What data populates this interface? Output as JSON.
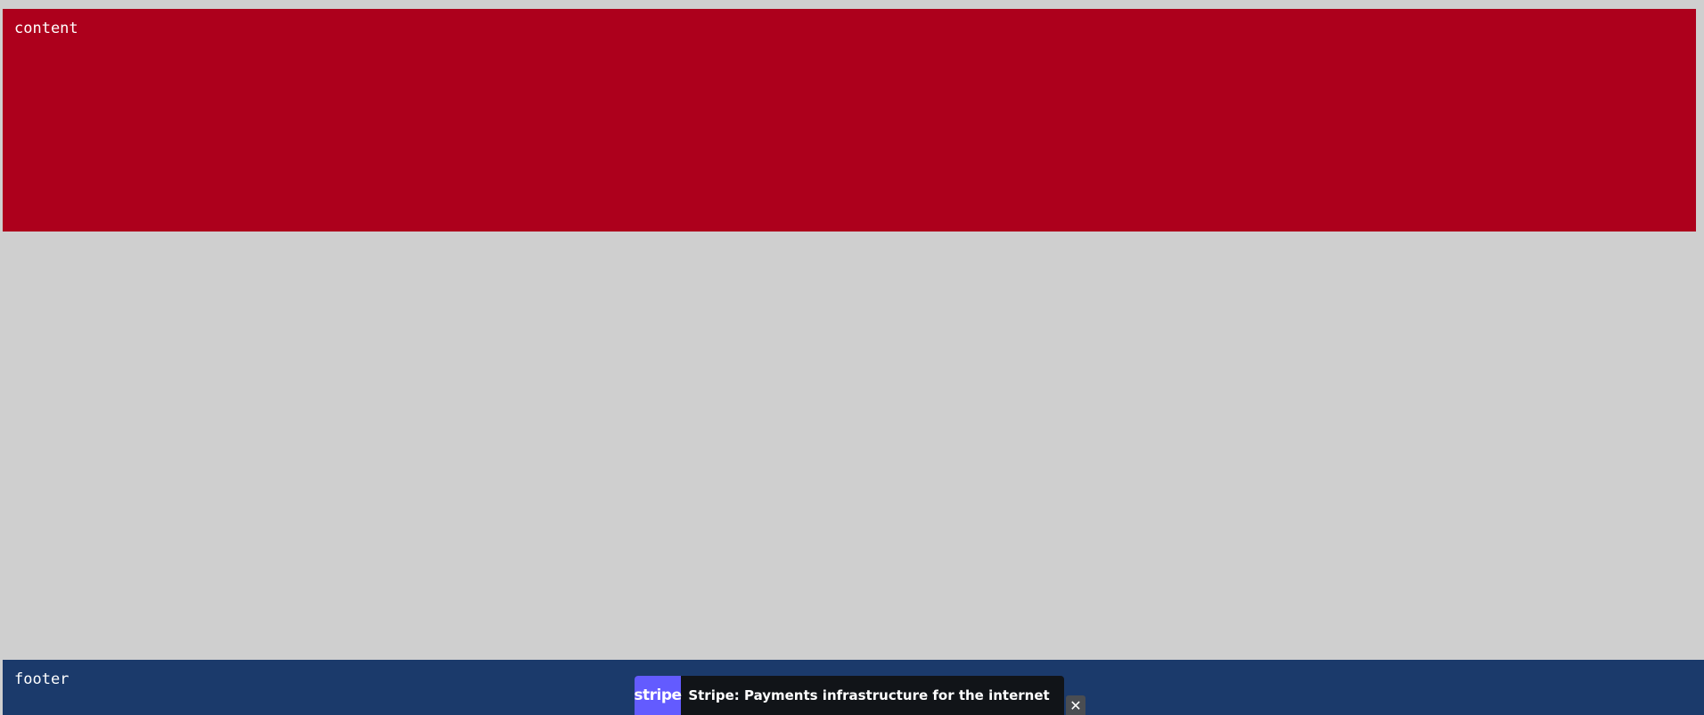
{
  "content": {
    "label": "content",
    "color": "#ad001c"
  },
  "footer": {
    "label": "footer",
    "color": "#1b3a6b"
  },
  "ad": {
    "logo_text": "stripe",
    "logo_color": "#635bff",
    "text": "Stripe: Payments infrastructure for the internet",
    "close_icon": "close-icon",
    "close_glyph": "✕"
  }
}
